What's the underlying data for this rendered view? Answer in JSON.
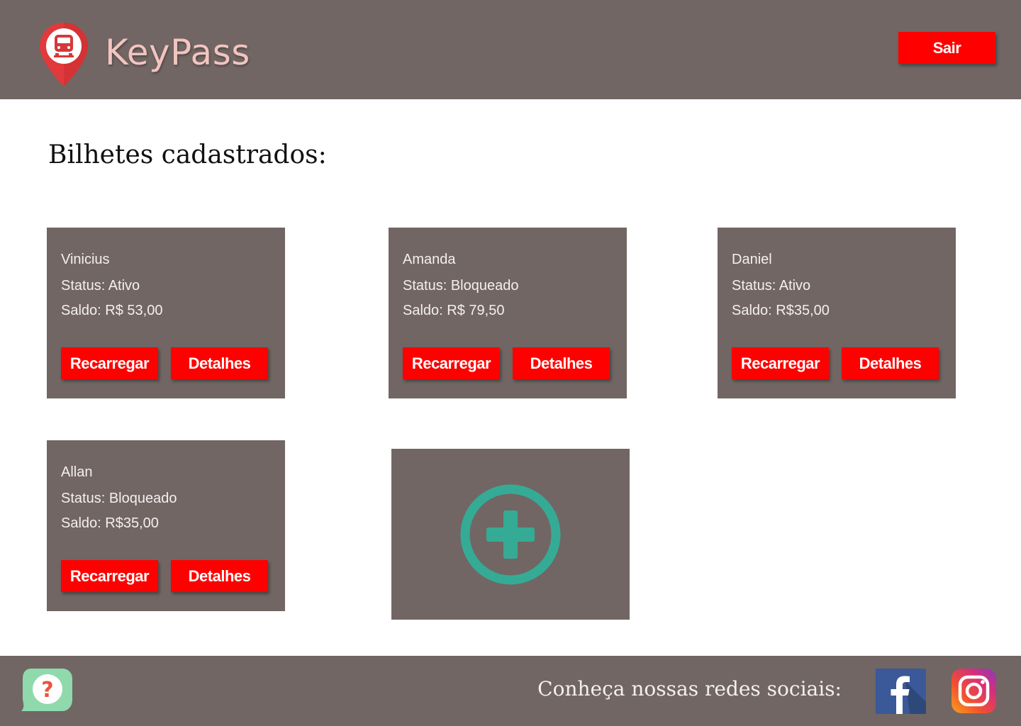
{
  "app": {
    "brand": "KeyPass",
    "logout_label": "Sair"
  },
  "main": {
    "title": "Bilhetes cadastrados:",
    "tickets": [
      {
        "name": "Vinicius",
        "status": "Status: Ativo",
        "balance": "Saldo: R$ 53,00",
        "recharge_label": "Recarregar",
        "details_label": "Detalhes"
      },
      {
        "name": "Amanda",
        "status": "Status: Bloqueado",
        "balance": "Saldo: R$ 79,50",
        "recharge_label": "Recarregar",
        "details_label": "Detalhes"
      },
      {
        "name": "Daniel",
        "status": "Status: Ativo",
        "balance": "Saldo: R$35,00",
        "recharge_label": "Recarregar",
        "details_label": "Detalhes"
      },
      {
        "name": "Allan",
        "status": "Status: Bloqueado",
        "balance": "Saldo: R$35,00",
        "recharge_label": "Recarregar",
        "details_label": "Detalhes"
      }
    ],
    "add_icon": "plus-circle-icon"
  },
  "footer": {
    "social_text": "Conheça nossas redes sociais:",
    "help_icon": "question-chat-icon",
    "facebook_icon": "facebook-icon",
    "instagram_icon": "instagram-icon"
  },
  "colors": {
    "header_bg": "#716664",
    "button_red": "#ff0000",
    "brand_pink": "#f2c4c0",
    "add_teal": "#35ab96"
  }
}
